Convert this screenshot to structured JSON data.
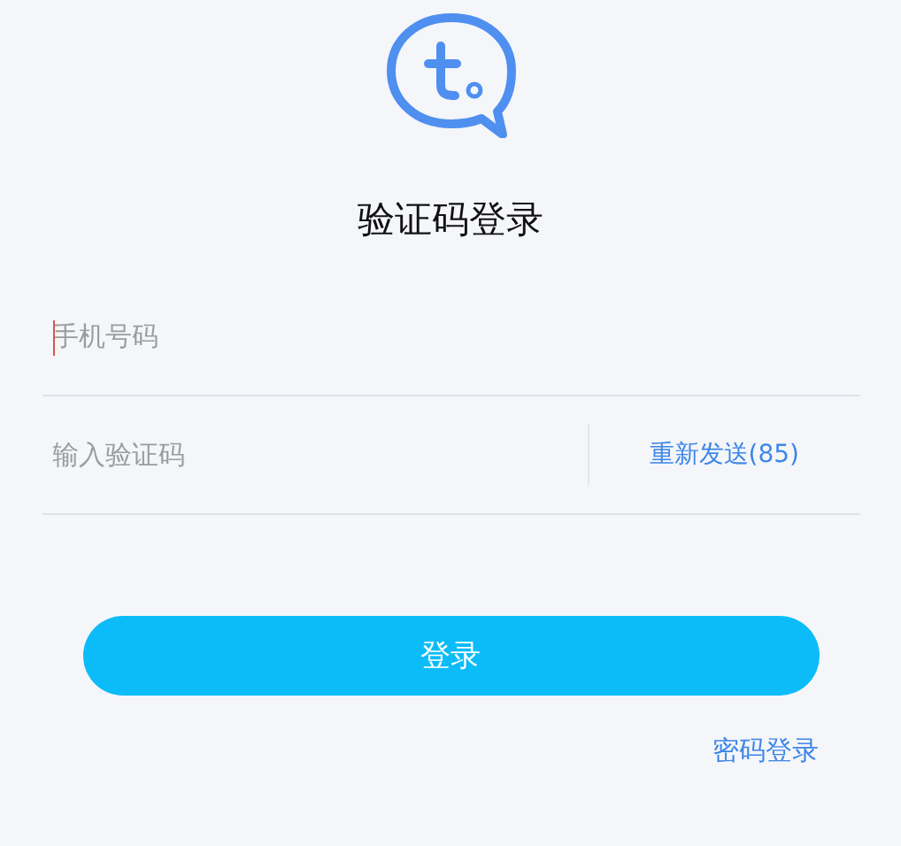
{
  "title": "验证码登录",
  "phone_field": {
    "placeholder": "手机号码",
    "focused": true
  },
  "code_field": {
    "placeholder": "输入验证码"
  },
  "resend_button": {
    "label": "重新发送(85)"
  },
  "login_button": {
    "label": "登录"
  },
  "password_login_link": {
    "label": "密码登录"
  }
}
